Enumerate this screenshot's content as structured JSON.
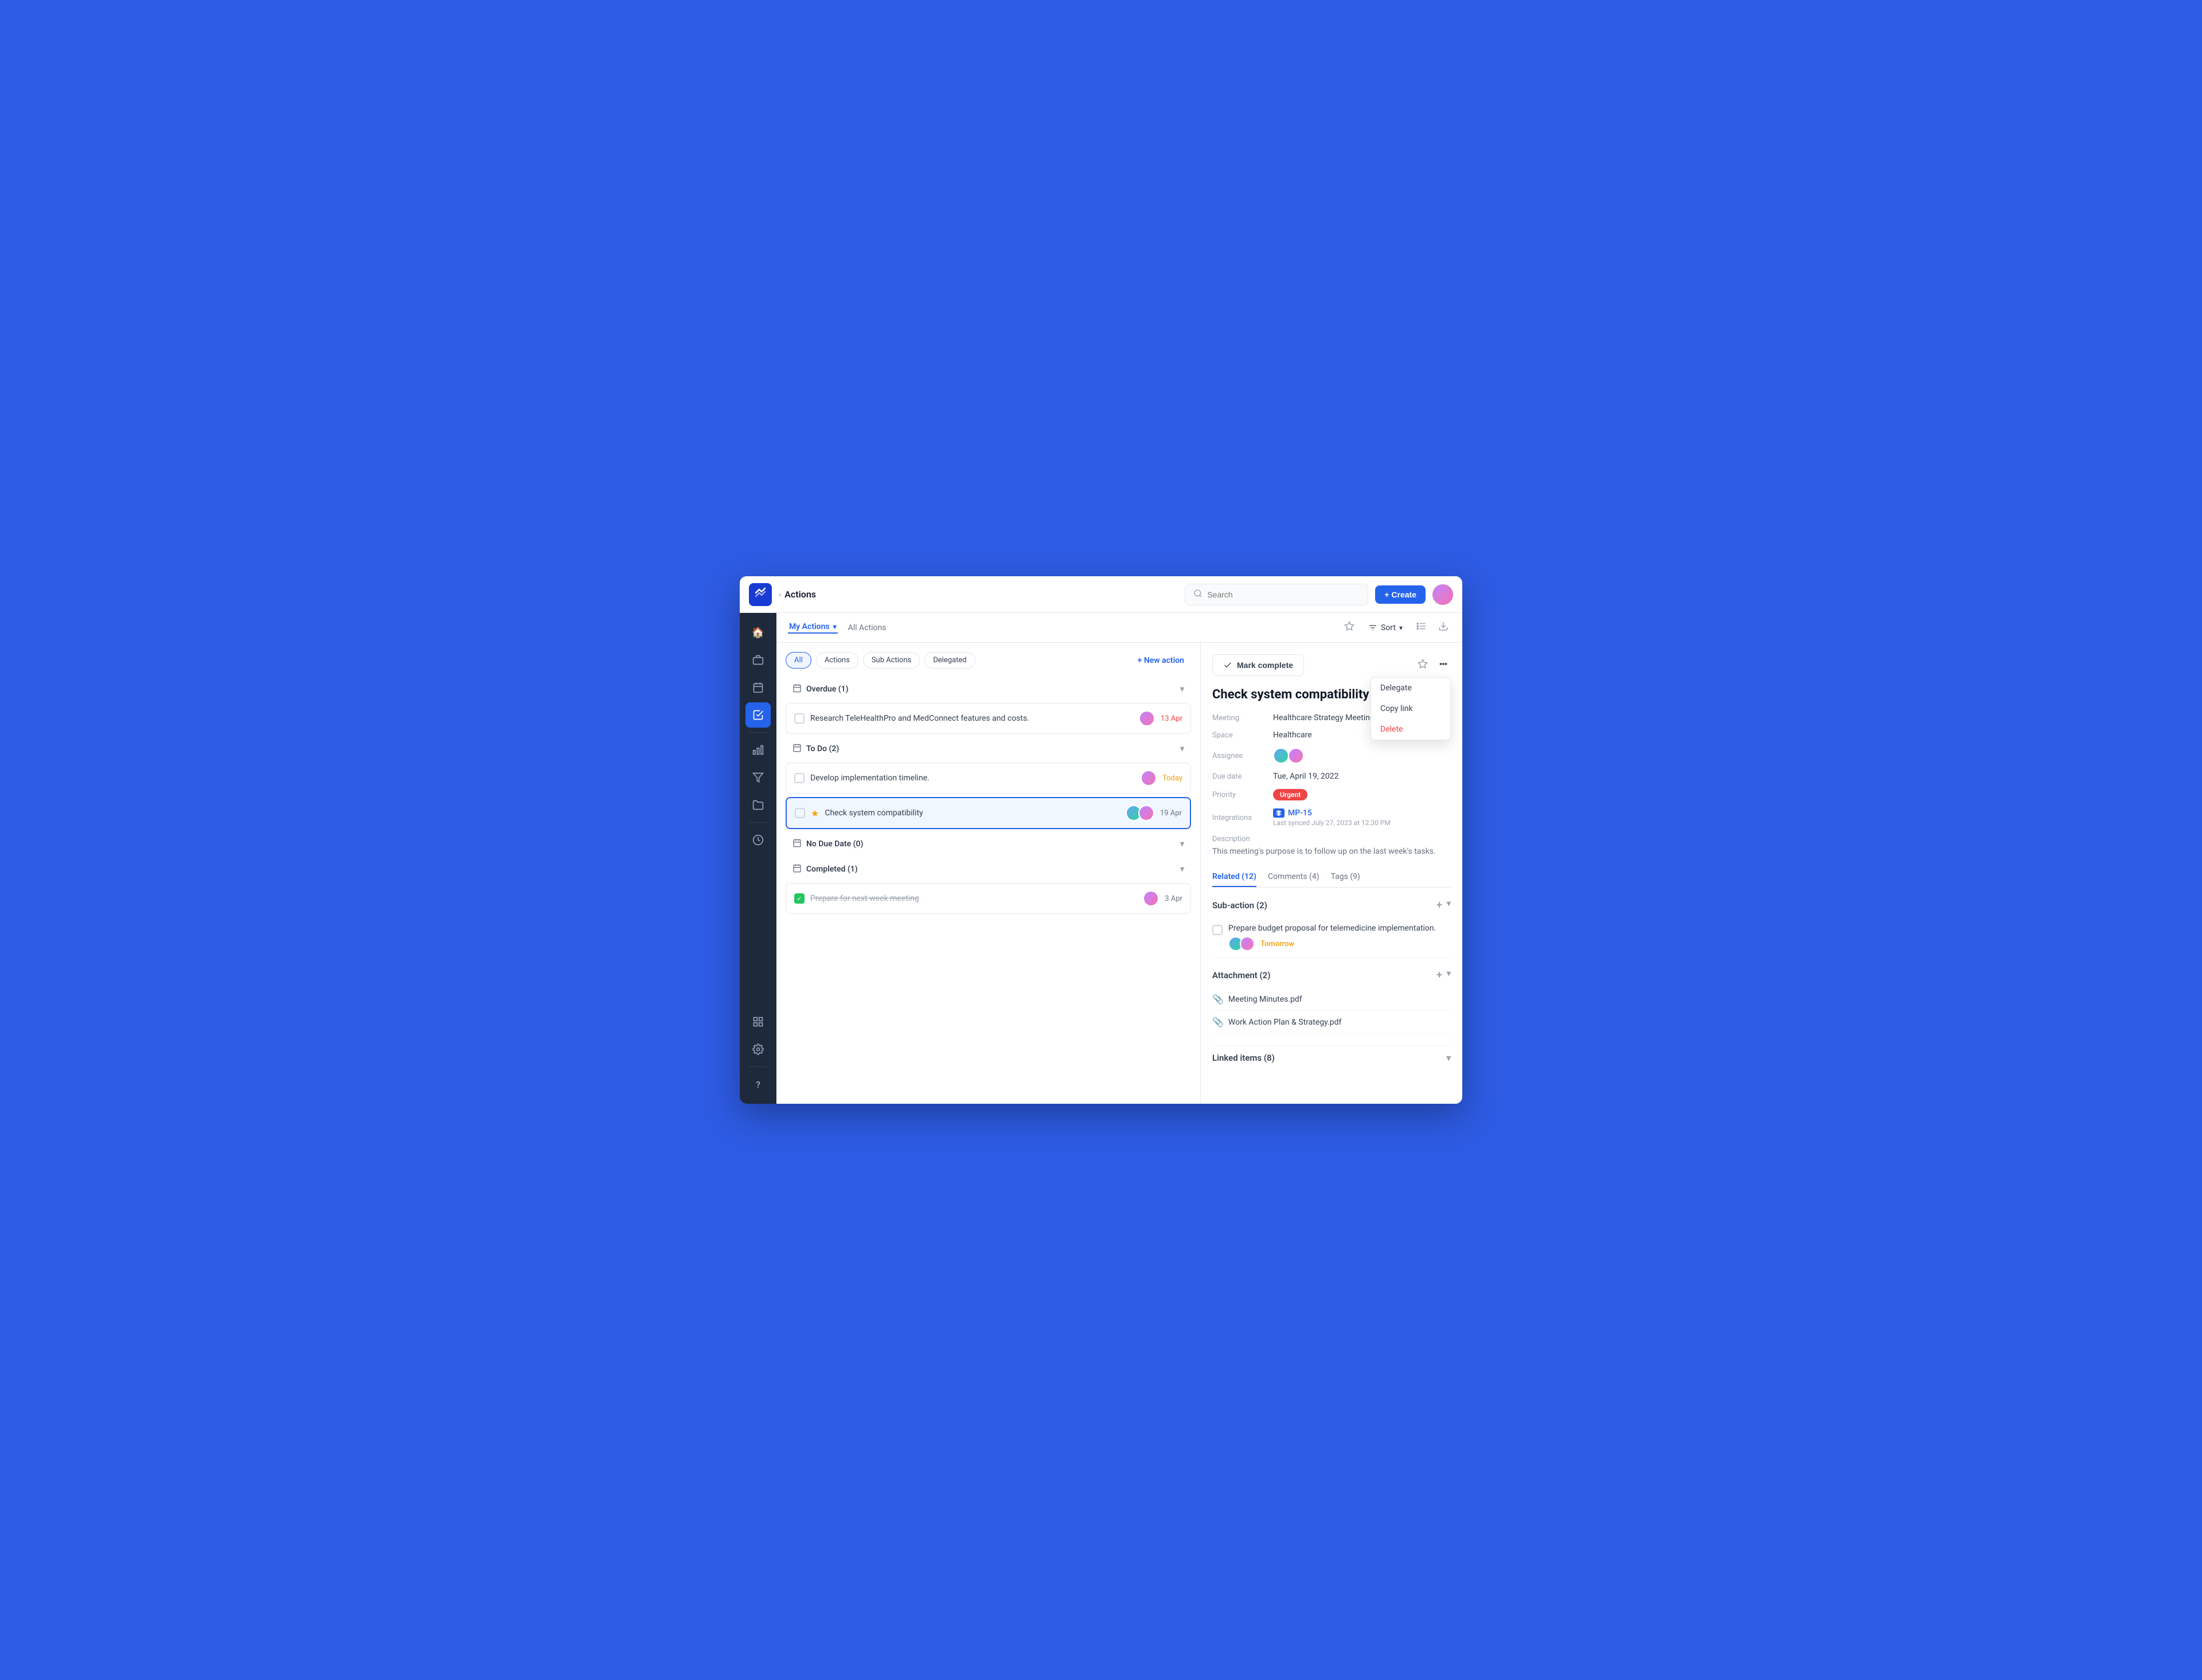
{
  "app": {
    "logo": "M",
    "breadcrumb_chevron": "›",
    "breadcrumb_title": "Actions"
  },
  "topbar": {
    "search_placeholder": "Search",
    "create_label": "+ Create"
  },
  "sub_header": {
    "tab_my_actions": "My Actions",
    "tab_all_actions": "All Actions",
    "sort_label": "Sort"
  },
  "filters": {
    "all": "All",
    "actions": "Actions",
    "sub_actions": "Sub Actions",
    "delegated": "Delegated",
    "new_action": "+ New action"
  },
  "sections": {
    "overdue": "Overdue (1)",
    "todo": "To Do (2)",
    "no_due_date": "No Due Date (0)",
    "completed": "Completed (1)"
  },
  "tasks": {
    "overdue": [
      {
        "text": "Research TeleHealthPro and MedConnect features and costs.",
        "date": "13 Apr",
        "date_class": "overdue",
        "avatar": "avatar-1"
      }
    ],
    "todo": [
      {
        "text": "Develop implementation timeline.",
        "date": "Today",
        "date_class": "today",
        "avatar": "avatar-1"
      },
      {
        "text": "Check system compatibility",
        "date": "19 Apr",
        "date_class": "",
        "avatar": "avatar-2",
        "starred": true,
        "selected": true
      }
    ],
    "completed": [
      {
        "text": "Prepare for next week meeting",
        "date": "3 Apr",
        "date_class": "",
        "avatar": "avatar-1",
        "checked": true
      }
    ]
  },
  "detail": {
    "mark_complete": "Mark complete",
    "title": "Check system compatibility",
    "meeting_label": "Meeting",
    "meeting_value": "Healthcare Strategy Meeting",
    "space_label": "Space",
    "space_value": "Healthcare",
    "assignee_label": "Assignee",
    "due_date_label": "Due date",
    "due_date_value": "Tue, April 19, 2022",
    "priority_label": "Priority",
    "priority_value": "Urgent",
    "integrations_label": "Integrations",
    "integration_link": "MP-15",
    "sync_text": "Last synced July 27, 2023 at 12:30 PM",
    "description_label": "Description",
    "description_text": "This meeting's purpose is to follow up on the last week's tasks.",
    "tabs": {
      "related": "Related (12)",
      "comments": "Comments (4)",
      "tags": "Tags (9)"
    },
    "sub_action_header": "Sub-action (2)",
    "sub_action_text": "Prepare budget proposal for telemedicine implementation.",
    "due_tomorrow": "Tomorrow",
    "attachment_header": "Attachment (2)",
    "attachments": [
      "Meeting Minutes.pdf",
      "Work Action Plan & Strategy.pdf"
    ],
    "linked_header": "Linked items (8)"
  },
  "dropdown": {
    "delegate": "Delegate",
    "copy_link": "Copy link",
    "delete": "Delete"
  },
  "sidebar": {
    "icons": [
      "🏠",
      "💼",
      "📅",
      "✅",
      "📊",
      "🔧",
      "📁",
      "—",
      "🕐"
    ],
    "bottom_icons": [
      "⊞",
      "⚙️",
      "—",
      "?"
    ]
  }
}
